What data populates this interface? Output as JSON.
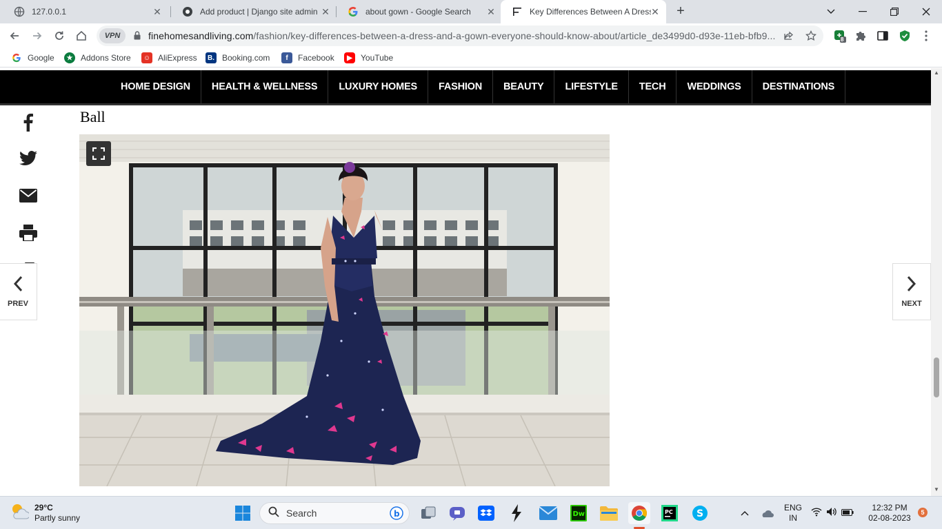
{
  "browser": {
    "tabs": [
      {
        "label": "127.0.0.1"
      },
      {
        "label": "Add product | Django site admin"
      },
      {
        "label": "about gown - Google Search"
      },
      {
        "label": "Key Differences Between A Dress"
      }
    ],
    "address": {
      "vpn_label": "VPN",
      "host": "finehomesandliving.com",
      "path": "/fashion/key-differences-between-a-dress-and-a-gown-everyone-should-know-about/article_de3499d0-d93e-11eb-bfb9..."
    },
    "extension_badge": "8",
    "bookmarks": [
      {
        "label": "Google"
      },
      {
        "label": "Addons Store"
      },
      {
        "label": "AliExpress"
      },
      {
        "label": "Booking.com"
      },
      {
        "label": "Facebook"
      },
      {
        "label": "YouTube"
      }
    ]
  },
  "site": {
    "nav": [
      "HOME DESIGN",
      "HEALTH & WELLNESS",
      "LUXURY HOMES",
      "FASHION",
      "BEAUTY",
      "LIFESTYLE",
      "TECH",
      "WEDDINGS",
      "DESTINATIONS"
    ],
    "section_title": "Ball",
    "pager": {
      "prev": "PREV",
      "next": "NEXT"
    },
    "share_icons": [
      "facebook-icon",
      "twitter-icon",
      "email-icon",
      "print-icon",
      "copy-icon",
      "bookmark-icon"
    ]
  },
  "taskbar": {
    "weather": {
      "temp": "29°C",
      "condition": "Partly sunny"
    },
    "search_label": "Search",
    "lang": {
      "line1": "ENG",
      "line2": "IN"
    },
    "clock": {
      "time": "12:32 PM",
      "date": "02-08-2023"
    },
    "notifications": "5"
  }
}
